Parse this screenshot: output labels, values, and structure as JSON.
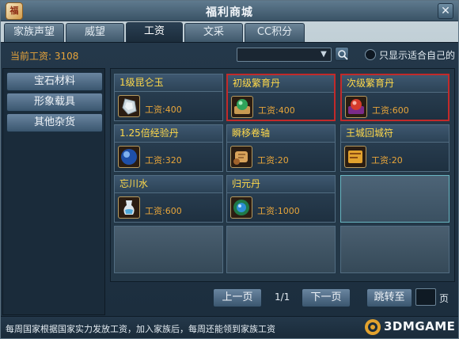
{
  "window": {
    "title": "福利商城",
    "logo_text": "福",
    "close_icon": "close-icon"
  },
  "tabs": [
    {
      "label": "家族声望",
      "active": false
    },
    {
      "label": "威望",
      "active": false
    },
    {
      "label": "工资",
      "active": true
    },
    {
      "label": "文采",
      "active": false
    },
    {
      "label": "CC积分",
      "active": false
    }
  ],
  "wage": {
    "label": "当前工资: 3108"
  },
  "filter": {
    "value": "",
    "arrow_icon": "chevron-down-icon",
    "search_icon": "search-icon"
  },
  "only_suitable": {
    "label": "只显示适合自己的",
    "checked": false
  },
  "categories": [
    {
      "label": "宝石材料"
    },
    {
      "label": "形象载具"
    },
    {
      "label": "其他杂货"
    }
  ],
  "items": [
    {
      "name": "1级昆仑玉",
      "wage": "工资:400",
      "icon": "jade-stone-icon",
      "selected": false
    },
    {
      "name": "初级繁育丹",
      "wage": "工资:400",
      "icon": "green-pill-icon",
      "selected": true
    },
    {
      "name": "次级繁育丹",
      "wage": "工资:600",
      "icon": "red-pill-icon",
      "selected": true
    },
    {
      "name": "1.25倍经验丹",
      "wage": "工资:320",
      "icon": "blue-orb-icon",
      "selected": false
    },
    {
      "name": "瞬移卷轴",
      "wage": "工资:20",
      "icon": "scroll-icon",
      "selected": false
    },
    {
      "name": "王城回城符",
      "wage": "工资:20",
      "icon": "return-scroll-icon",
      "selected": false
    },
    {
      "name": "忘川水",
      "wage": "工资:600",
      "icon": "water-flask-icon",
      "selected": false
    },
    {
      "name": "归元丹",
      "wage": "工资:1000",
      "icon": "orb-pill-icon",
      "selected": false
    }
  ],
  "pager": {
    "prev": "上一页",
    "page": "1/1",
    "next": "下一页",
    "jump": "跳转至",
    "unit": "页"
  },
  "footer": {
    "text": "每周国家根据国家实力发放工资，加入家族后，每周还能领到家族工资"
  },
  "watermark": {
    "text": "3DMGAME"
  },
  "colors": {
    "wage_orange": "#e8a53a",
    "item_name_yellow": "#ffd94a",
    "selected_red": "#c22a2a"
  }
}
